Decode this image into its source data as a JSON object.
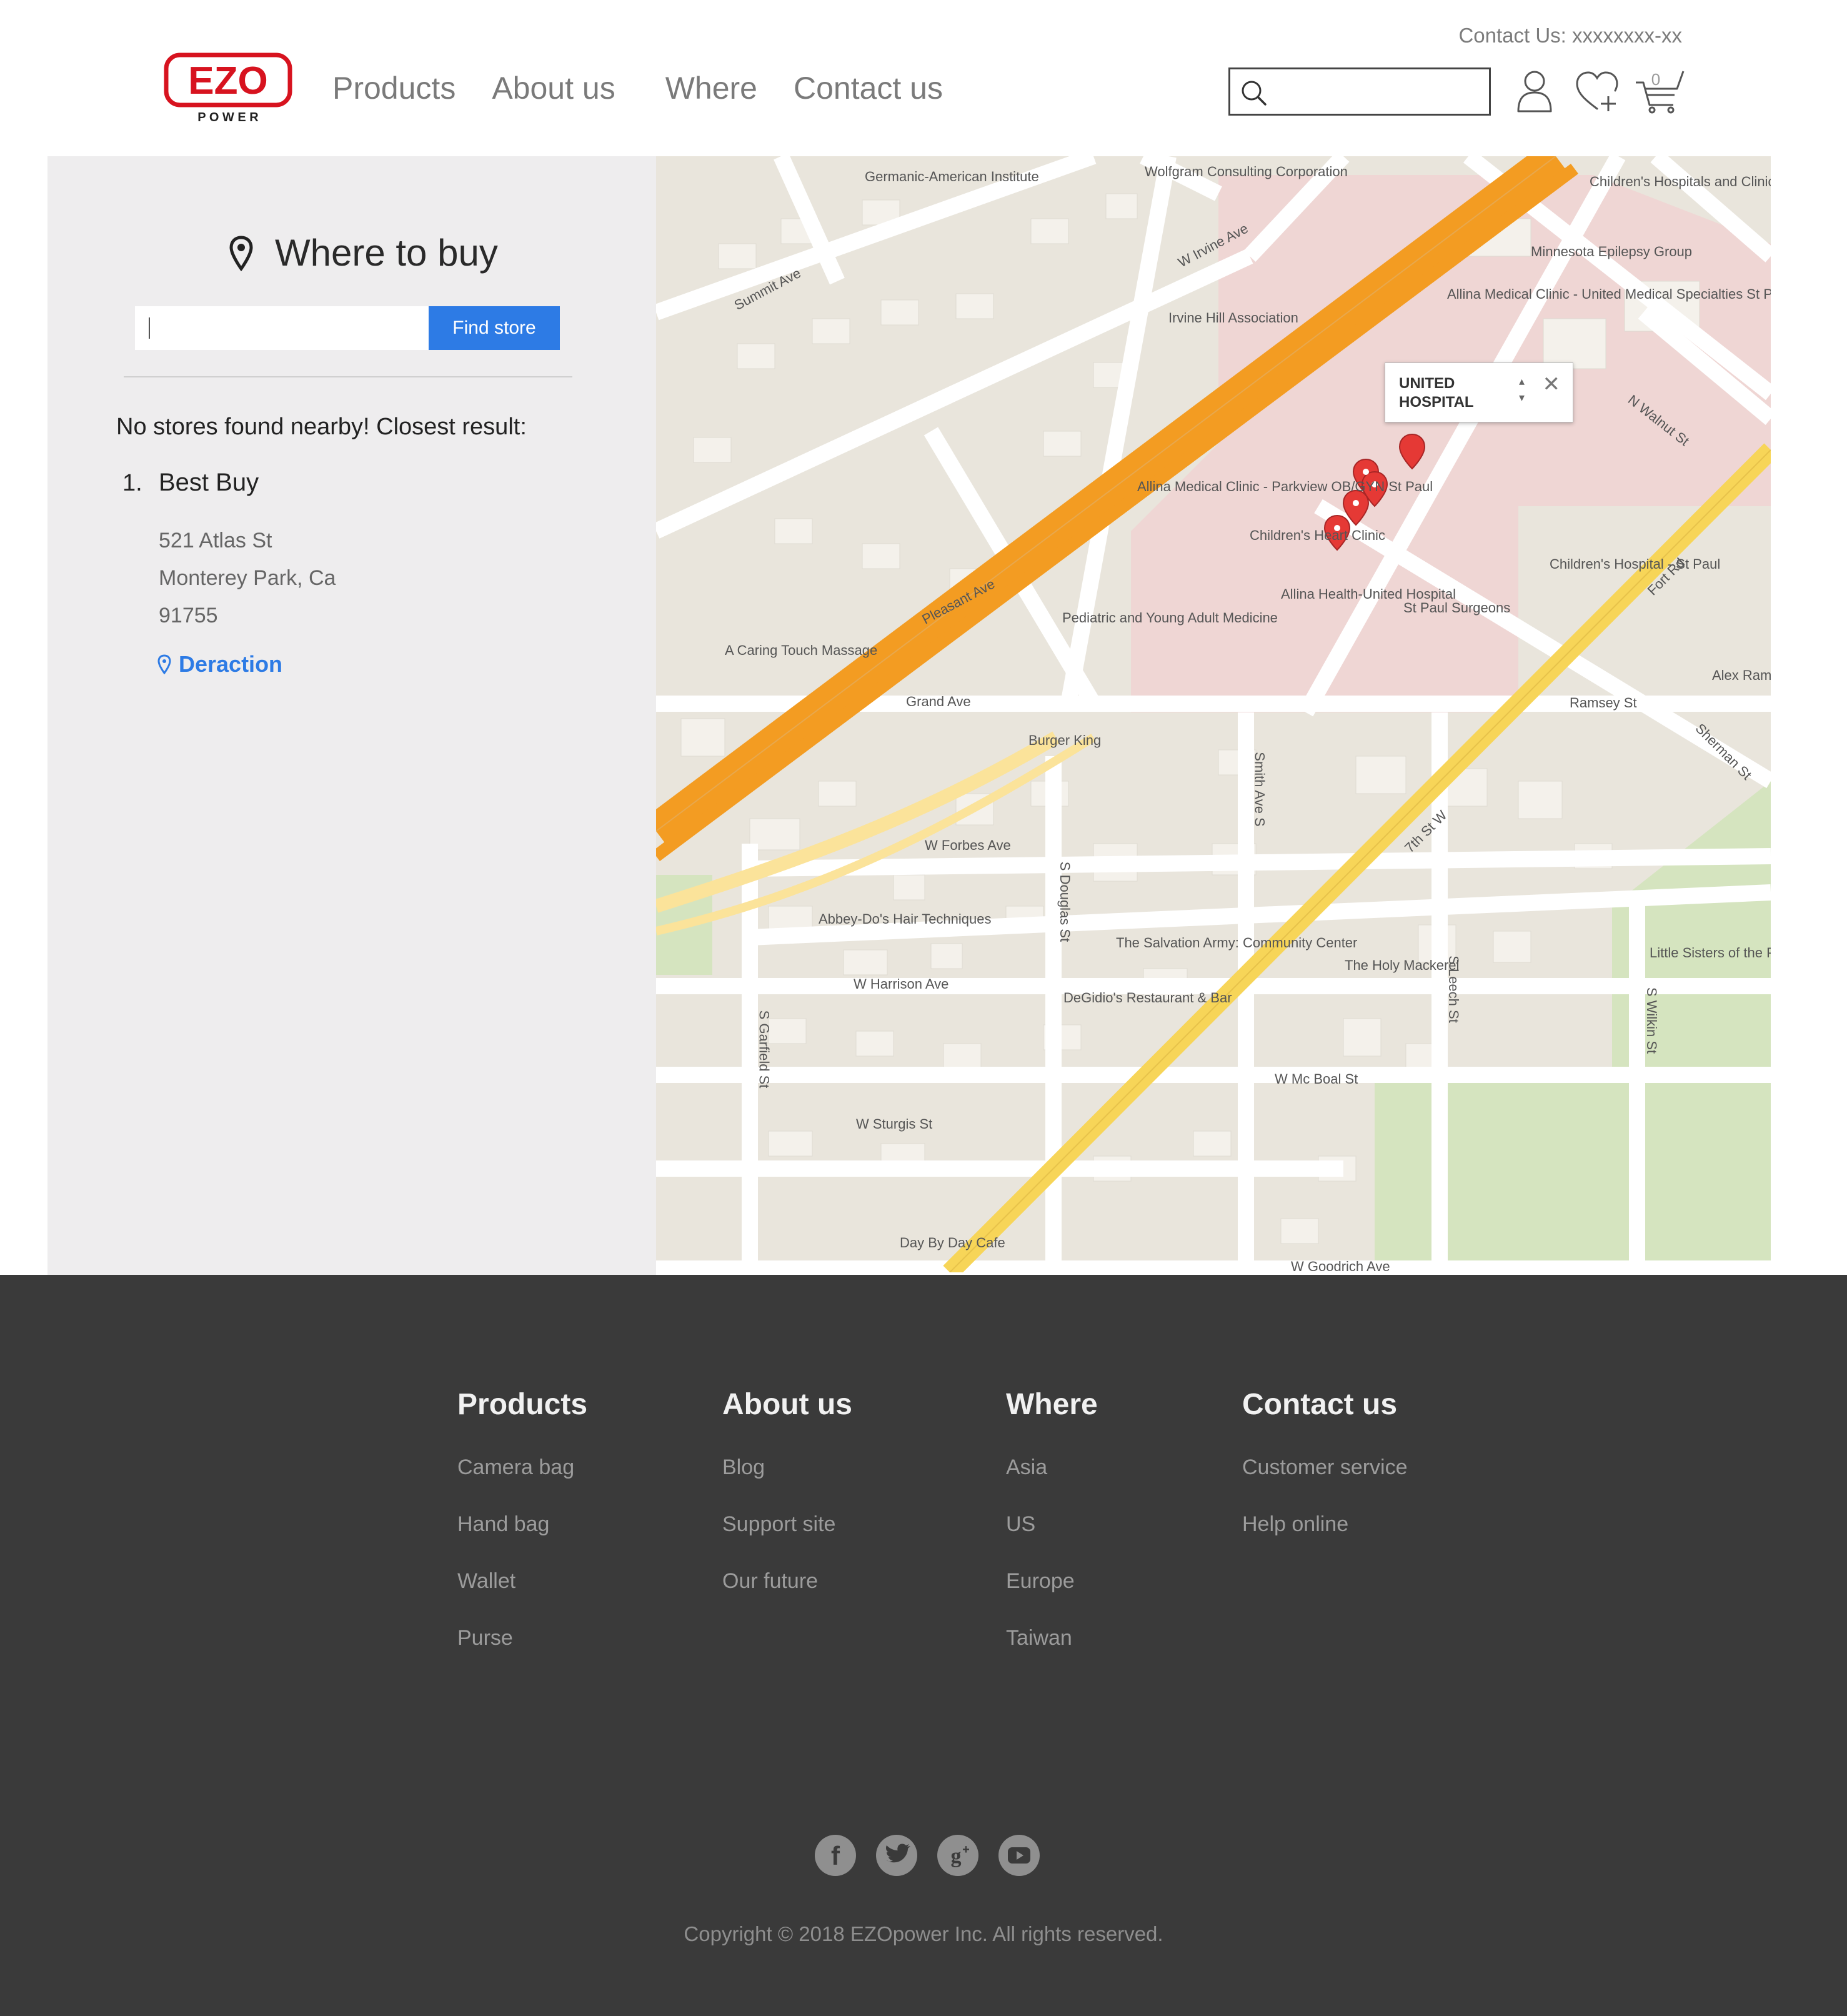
{
  "header": {
    "contact_line": "Contact Us: xxxxxxxx-xx",
    "logo_text": "EZO",
    "logo_sub": "P O W E R",
    "nav": [
      "Products",
      "About us",
      "Where",
      "Contact us"
    ],
    "search_placeholder": "",
    "cart_count": "0"
  },
  "store_locator": {
    "title": "Where to buy",
    "input_value": "",
    "find_button": "Find store",
    "status": "No stores found nearby! Closest result:",
    "results": [
      {
        "number": "1.",
        "name": "Best Buy",
        "street": "521 Atlas St",
        "city": "Monterey Park, Ca",
        "zip": "91755",
        "directions_label": "Deraction"
      }
    ]
  },
  "map": {
    "popup_title": "UNITED HOSPITAL",
    "popup_close": "✕",
    "labels": [
      "Germanic-American Institute",
      "Wolfgram Consulting Corporation",
      "Children's Hospitals and Clinics of Minnesota",
      "Minnesota Epilepsy Group",
      "Allina Medical Clinic - United Medical Specialties St Paul",
      "Irvine Hill Association",
      "W Irvine Ave",
      "Summit Ave",
      "Pleasant Ave",
      "Allina Medical Clinic - Parkview OB/GYN St Paul",
      "Children's Heart Clinic",
      "Allina Health-United Hospital",
      "St Paul Surgeons",
      "Children's Hospital - St Paul",
      "Pediatric and Young Adult Medicine",
      "A Caring Touch Massage",
      "Grand Ave",
      "Ramsey St",
      "Burger King",
      "W Forbes Ave",
      "Abbey-Do's Hair Techniques",
      "The Salvation Army: Community Center",
      "The Holy Mackerel",
      "Little Sisters of the Poor",
      "W Harrison Ave",
      "DeGidio's Restaurant & Bar",
      "W Mc Boal St",
      "W Sturgis St",
      "Day By Day Cafe",
      "W Goodrich Ave",
      "7th St W",
      "Fort Rd",
      "Smith Ave S",
      "S Leech St",
      "S Douglas St",
      "S Garfield St",
      "S Wilkin St",
      "N Walnut St",
      "Sherman St",
      "Alex Ramsey"
    ]
  },
  "footer": {
    "columns": [
      {
        "title": "Products",
        "links": [
          "Camera bag",
          "Hand bag",
          "Wallet",
          "Purse"
        ]
      },
      {
        "title": "About us",
        "links": [
          "Blog",
          "Support site",
          "Our future"
        ]
      },
      {
        "title": "Where",
        "links": [
          "Asia",
          "US",
          "Europe",
          "Taiwan"
        ]
      },
      {
        "title": "Contact us",
        "links": [
          "Customer service",
          "Help online"
        ]
      }
    ],
    "social": [
      "facebook-icon",
      "twitter-icon",
      "google-plus-icon",
      "youtube-icon"
    ],
    "copyright": "Copyright © 2018 EZOpower Inc. All rights reserved."
  },
  "colors": {
    "brand_red": "#d7131f",
    "accent_blue": "#2d7be5",
    "footer_bg": "#3a3a3a",
    "panel_bg": "#eeedee",
    "highway_orange": "#f39c22",
    "road_yellow": "#f7d558"
  }
}
